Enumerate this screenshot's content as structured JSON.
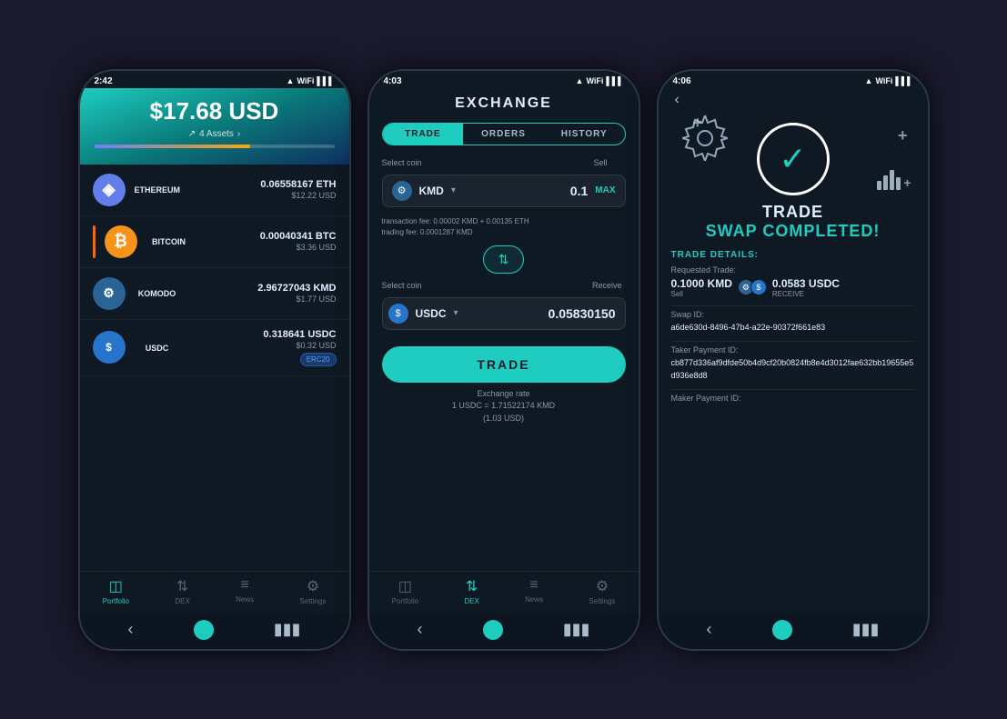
{
  "phone1": {
    "status_time": "2:42",
    "header": {
      "amount": "$17.68 USD",
      "assets_link": "4 Assets",
      "progress_percent": 65
    },
    "coins": [
      {
        "name": "ETHEREUM",
        "symbol": "ETH",
        "amount": "0.06558167 ETH",
        "usd": "$12.22 USD",
        "icon_type": "eth",
        "has_bar": false
      },
      {
        "name": "BITCOIN",
        "symbol": "BTC",
        "amount": "0.00040341 BTC",
        "usd": "$3.36 USD",
        "icon_type": "btc",
        "has_bar": true
      },
      {
        "name": "KOMODO",
        "symbol": "KMD",
        "amount": "2.96727043 KMD",
        "usd": "$1.77 USD",
        "icon_type": "kmd",
        "has_bar": false
      },
      {
        "name": "USDC",
        "symbol": "USDC",
        "amount": "0.318641 USDC",
        "usd": "$0.32 USD",
        "icon_type": "usdc",
        "has_bar": false,
        "badge": "ERC20"
      }
    ],
    "nav": {
      "items": [
        {
          "label": "Portfolio",
          "icon": "◫",
          "active": true
        },
        {
          "label": "DEX",
          "icon": "⇅",
          "active": false
        },
        {
          "label": "News",
          "icon": "≡",
          "active": false
        },
        {
          "label": "Settings",
          "icon": "⚙",
          "active": false
        }
      ]
    }
  },
  "phone2": {
    "status_time": "4:03",
    "title": "EXCHANGE",
    "tabs": [
      {
        "label": "TRADE",
        "active": true
      },
      {
        "label": "ORDERS",
        "active": false
      },
      {
        "label": "HISTORY",
        "active": false
      }
    ],
    "sell_section": {
      "select_label": "Select coin",
      "sell_label": "Sell",
      "coin": "KMD",
      "value": "0.1",
      "max_label": "MAX"
    },
    "fees": {
      "transaction": "transaction fee:  0.00002 KMD + 0.00135 ETH",
      "trading": "trading fee:           0.0001287 KMD"
    },
    "receive_section": {
      "select_label": "Select coin",
      "receive_label": "Receive",
      "coin": "USDC",
      "value": "0.05830150"
    },
    "trade_button": "TRADE",
    "exchange_rate": {
      "line1": "Exchange rate",
      "line2": "1 USDC = 1.71522174 KMD",
      "line3": "(1.03 USD)"
    },
    "nav": {
      "items": [
        {
          "label": "Portfolio",
          "icon": "◫",
          "active": false
        },
        {
          "label": "DEX",
          "icon": "⇅",
          "active": true
        },
        {
          "label": "News",
          "icon": "≡",
          "active": false
        },
        {
          "label": "Settings",
          "icon": "⚙",
          "active": false
        }
      ]
    }
  },
  "phone3": {
    "status_time": "4:06",
    "title_line1": "TRADE",
    "title_line2": "SWAP COMPLETED!",
    "trade_details": {
      "section_title": "TRADE DETAILS:",
      "requested_label": "Requested Trade:",
      "sell_amount": "0.1000 KMD",
      "sell_tag": "Sell",
      "receive_amount": "0.0583 USDC",
      "receive_tag": "RECEIVE",
      "swap_id_label": "Swap ID:",
      "swap_id": "a6de630d-8496-47b4-a22e-90372f661e83",
      "taker_payment_label": "Taker Payment ID:",
      "taker_payment_id": "cb877d336af9dfde50b4d9cf20b0824fb8e4d3012fae632bb19655e5d936e8d8",
      "maker_payment_label": "Maker Payment ID:"
    }
  }
}
